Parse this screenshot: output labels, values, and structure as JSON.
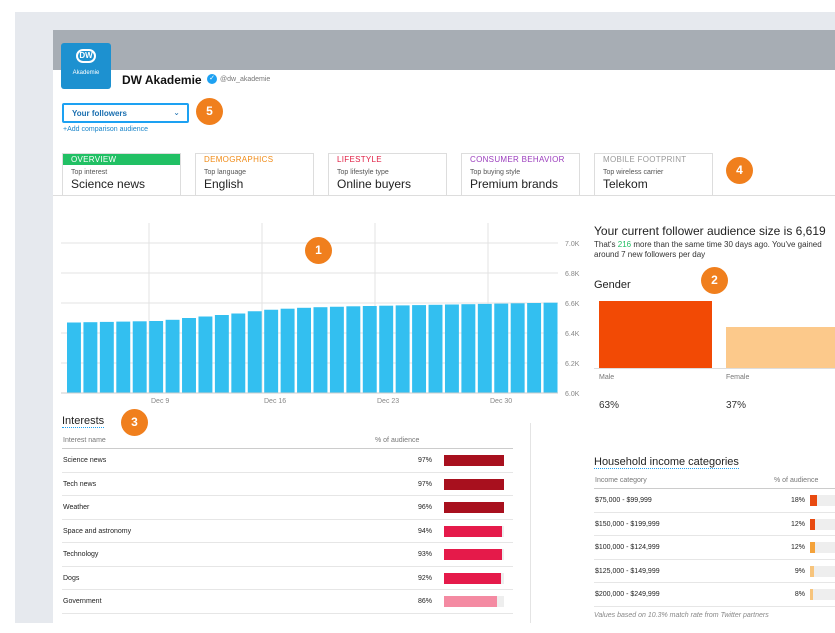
{
  "account": {
    "logo_text": "DW",
    "logo_sub": "Akademie",
    "name": "DW Akademie",
    "verified_glyph": "✓",
    "handle": "@dw_akademie"
  },
  "audience_selector": {
    "selected": "Your followers",
    "chevron": "⌄",
    "add_comparison": "+Add comparison audience"
  },
  "badges": [
    "1",
    "2",
    "3",
    "4",
    "5"
  ],
  "tabs": [
    {
      "title": "OVERVIEW",
      "sub": "Top interest",
      "value": "Science news",
      "color": "#21c064"
    },
    {
      "title": "DEMOGRAPHICS",
      "sub": "Top language",
      "value": "English",
      "color": "#f08b17"
    },
    {
      "title": "LIFESTYLE",
      "sub": "Top lifestyle type",
      "value": "Online buyers",
      "color": "#e02045"
    },
    {
      "title": "CONSUMER BEHAVIOR",
      "sub": "Top buying style",
      "value": "Premium brands",
      "color": "#9b3dbd"
    },
    {
      "title": "MOBILE FOOTPRINT",
      "sub": "Top wireless carrier",
      "value": "Telekom",
      "color": "#999999"
    }
  ],
  "chart_data": {
    "type": "bar",
    "categories": [
      "",
      "",
      "",
      "",
      "",
      "",
      "",
      "",
      "",
      "",
      "",
      "",
      "",
      "",
      "",
      "",
      "",
      "",
      "",
      "",
      "",
      "",
      "",
      "",
      "",
      "",
      "",
      "",
      "",
      ""
    ],
    "x_tick_labels": [
      "Dec 9",
      "Dec 16",
      "Dec 23",
      "Dec 30"
    ],
    "values": [
      6470,
      6472,
      6474,
      6476,
      6478,
      6480,
      6488,
      6500,
      6510,
      6520,
      6530,
      6545,
      6555,
      6562,
      6568,
      6572,
      6575,
      6578,
      6580,
      6582,
      6584,
      6586,
      6588,
      6590,
      6592,
      6594,
      6596,
      6598,
      6600,
      6602
    ],
    "ylim": [
      6000,
      7000
    ],
    "y_tick_labels": [
      "7.0K",
      "6.8K",
      "6.6K",
      "6.4K",
      "6.2K",
      "6.0K"
    ],
    "color": "#33bff0",
    "grid": true
  },
  "audience": {
    "title": "Your current follower audience size is 6,619",
    "desc_pre": "That's ",
    "desc_delta": "216",
    "desc_post": " more than the same time 30 days ago. You've gained around 7 new followers per day"
  },
  "gender": {
    "title": "Gender",
    "male_label": "Male",
    "female_label": "Female",
    "male_pct": "63%",
    "female_pct": "37%",
    "male_value": 63,
    "female_value": 37,
    "male_color": "#f24a05",
    "female_color": "#fcc98b"
  },
  "interests": {
    "title": "Interests",
    "col_name": "Interest name",
    "col_pct": "% of audience",
    "rows": [
      {
        "name": "Science news",
        "pct": "97%",
        "value": 97,
        "color": "#a8101e"
      },
      {
        "name": "Tech news",
        "pct": "97%",
        "value": 97,
        "color": "#a8101e"
      },
      {
        "name": "Weather",
        "pct": "96%",
        "value": 96,
        "color": "#a8101e"
      },
      {
        "name": "Space and astronomy",
        "pct": "94%",
        "value": 94,
        "color": "#e51a4a"
      },
      {
        "name": "Technology",
        "pct": "93%",
        "value": 93,
        "color": "#e51a4a"
      },
      {
        "name": "Dogs",
        "pct": "92%",
        "value": 92,
        "color": "#e51a4a"
      },
      {
        "name": "Government",
        "pct": "86%",
        "value": 86,
        "color": "#f48aa2"
      }
    ]
  },
  "income": {
    "title": "Household income categories",
    "col_name": "Income category",
    "col_pct": "% of audience",
    "rows": [
      {
        "name": "$75,000 - $99,999",
        "pct": "18%",
        "value": 18,
        "color": "#e84a10"
      },
      {
        "name": "$150,000 - $199,999",
        "pct": "12%",
        "value": 12,
        "color": "#e84a10"
      },
      {
        "name": "$100,000 - $124,999",
        "pct": "12%",
        "value": 12,
        "color": "#f4a23a"
      },
      {
        "name": "$125,000 - $149,999",
        "pct": "9%",
        "value": 9,
        "color": "#f7c47c"
      },
      {
        "name": "$200,000 - $249,999",
        "pct": "8%",
        "value": 8,
        "color": "#f7c47c"
      }
    ],
    "note": "Values based on 10.3% match rate from Twitter partners"
  }
}
